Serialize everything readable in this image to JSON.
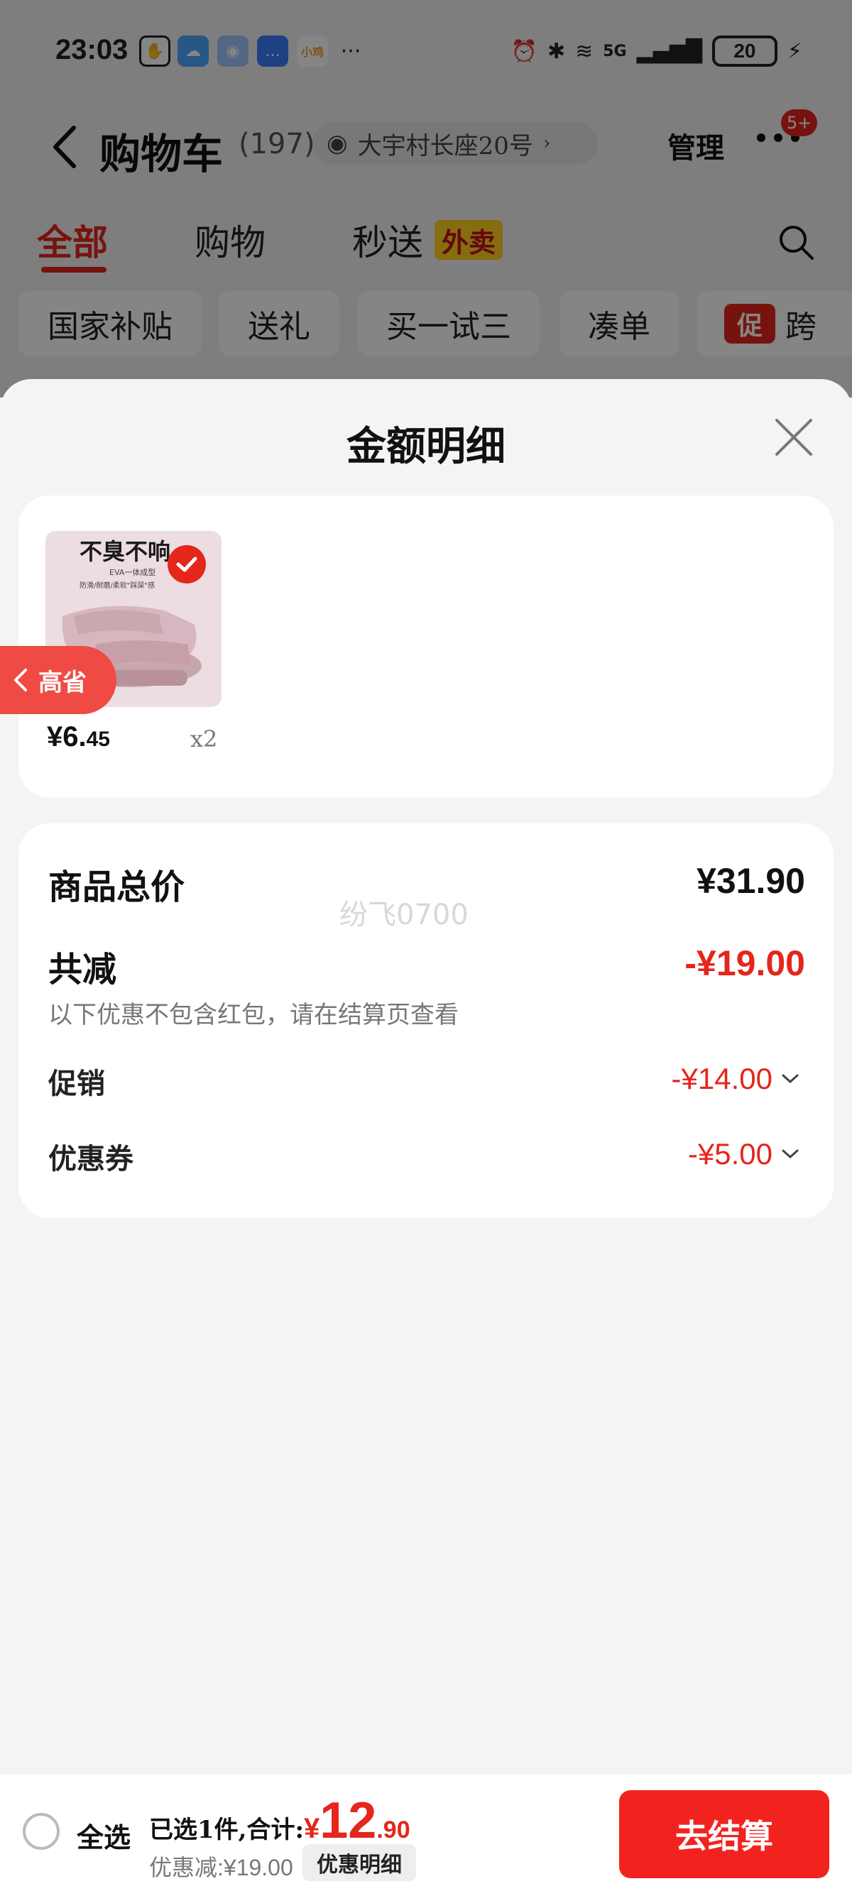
{
  "status_bar": {
    "time": "23:03",
    "app_icons": [
      "hand-icon",
      "weather-app-icon",
      "assistant-app-icon",
      "message-app-icon",
      "xiaohongshu-app-icon"
    ],
    "app_labels": {
      "xiaohongshu": "小鸡"
    },
    "more": "···",
    "network": "5G",
    "battery": "20"
  },
  "header": {
    "title": "购物车",
    "count": "(197)",
    "address": "大宇村长座20号",
    "manage": "管理",
    "badge": "5+"
  },
  "tabs": [
    {
      "label": "全部",
      "active": true
    },
    {
      "label": "购物",
      "active": false
    },
    {
      "label": "秒送",
      "active": false,
      "tag": "外卖"
    }
  ],
  "chips": [
    "国家补贴",
    "送礼",
    "买一试三",
    "凑单",
    "跨"
  ],
  "chip_promo": "促",
  "sheet": {
    "title": "金额明细",
    "product": {
      "thumb_title": "不臭不响",
      "thumb_subtitle": "EVA一体成型",
      "thumb_note": "防滑/耐磨/柔软\"踩屎\"感",
      "price_int": "¥6.",
      "price_dec": "45",
      "qty": "x2"
    },
    "side_tab": "高省",
    "watermark": "纷飞0700",
    "summary": {
      "total_label": "商品总价",
      "total_value": "¥31.90",
      "discount_label": "共减",
      "discount_value": "-¥19.00",
      "note": "以下优惠不包含红包，请在结算页查看",
      "promo_label": "促销",
      "promo_value": "-¥14.00",
      "coupon_label": "优惠券",
      "coupon_value": "-¥5.00"
    }
  },
  "bottom_bar": {
    "select_all": "全选",
    "selected": "已选1件,合计:",
    "total_currency": "¥",
    "total_int": "12",
    "total_dec": ".90",
    "discount": "优惠减:¥19.00",
    "detail": "优惠明细",
    "checkout": "去结算"
  },
  "colors": {
    "accent": "#e4261b",
    "takeout": "#ffd21f",
    "checkout": "#f2231f"
  }
}
